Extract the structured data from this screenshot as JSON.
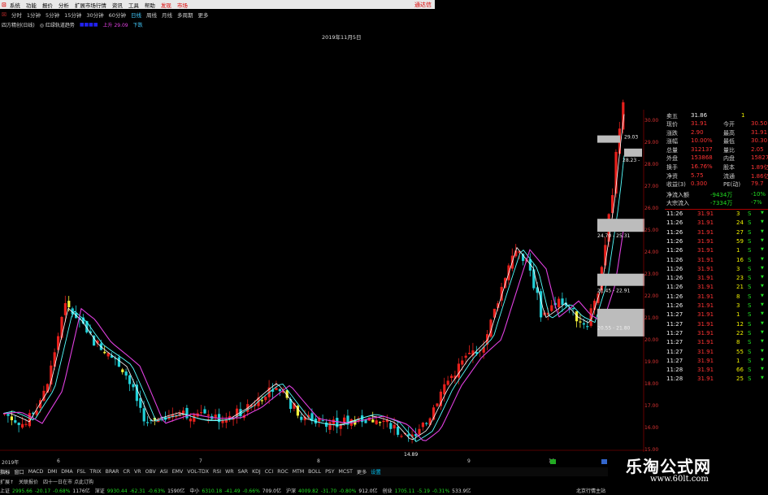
{
  "menubar": {
    "items": [
      "系统",
      "功能",
      "报价",
      "分析",
      "扩展市场行情",
      "资讯",
      "工具",
      "帮助"
    ],
    "highlight": [
      "发现",
      "市场"
    ],
    "close_label": "通达信"
  },
  "periods": {
    "items": [
      "分时",
      "1分钟",
      "5分钟",
      "15分钟",
      "30分钟",
      "60分钟",
      "日线",
      "周线",
      "月线",
      "多周期",
      "更多"
    ],
    "selected": "日线"
  },
  "indicator_line": {
    "name": "四方精创(日线)",
    "study": "◎ 红绿轨道趋势",
    "v1": "上升 29.09",
    "v2": "下跌"
  },
  "chart": {
    "date_header": "2019年11月5日",
    "price_ticks": [
      "30.00",
      "29.00",
      "28.00",
      "27.00",
      "26.00",
      "25.00",
      "24.00",
      "23.00",
      "22.00",
      "21.00",
      "20.00",
      "19.00",
      "18.00",
      "17.00",
      "16.00",
      "15.00"
    ],
    "low_label": "14.89",
    "zone_labels": [
      "29.03",
      "28.23 -",
      "24.70 - 25.31",
      "21.45 - 22.91",
      "20.55 - 21.80"
    ],
    "x_labels": [
      "2019年",
      "6",
      "7",
      "8",
      "9",
      "10"
    ],
    "colors": {
      "up": "#e8201c",
      "down": "#22d0d8",
      "yellow": "#f5f23a",
      "ma_white": "#ffffff",
      "ma_cyan": "#5ff",
      "ma_magenta": "#e040e0"
    }
  },
  "quote_panel": {
    "top": [
      {
        "label": "卖五",
        "value": "31.86",
        "vol": "1"
      },
      {
        "label": "现价",
        "value": "31.91",
        "k2": "今开",
        "v2": "30.50"
      },
      {
        "label": "涨跌",
        "value": "2.90",
        "k2": "最高",
        "v2": "31.91"
      },
      {
        "label": "涨幅",
        "value": "10.00%",
        "k2": "最低",
        "v2": "30.30"
      },
      {
        "label": "总量",
        "value": "312137",
        "k2": "量比",
        "v2": "2.05"
      },
      {
        "label": "外盘",
        "value": "153868",
        "k2": "内盘",
        "v2": "158277"
      },
      {
        "label": "换手",
        "value": "16.76%",
        "k2": "股本",
        "v2": "1.89亿"
      },
      {
        "label": "净资",
        "value": "5.75",
        "k2": "流通",
        "v2": "1.86亿"
      },
      {
        "label": "收益(3)",
        "value": "0.300",
        "k2": "PE(动)",
        "v2": "79.7"
      },
      {
        "label": "净流入额",
        "value": "-9434万",
        "v2": "-10%"
      },
      {
        "label": "大宗流入",
        "value": "-7334万",
        "v2": "-7%"
      }
    ],
    "ticks": [
      {
        "t": "11:26",
        "p": "31.91",
        "v": "3",
        "s": "S"
      },
      {
        "t": "11:26",
        "p": "31.91",
        "v": "24",
        "s": "S"
      },
      {
        "t": "11:26",
        "p": "31.91",
        "v": "27",
        "s": "S"
      },
      {
        "t": "11:26",
        "p": "31.91",
        "v": "59",
        "s": "S"
      },
      {
        "t": "11:26",
        "p": "31.91",
        "v": "1",
        "s": "S"
      },
      {
        "t": "11:26",
        "p": "31.91",
        "v": "16",
        "s": "S"
      },
      {
        "t": "11:26",
        "p": "31.91",
        "v": "3",
        "s": "S"
      },
      {
        "t": "11:26",
        "p": "31.91",
        "v": "23",
        "s": "S"
      },
      {
        "t": "11:26",
        "p": "31.91",
        "v": "21",
        "s": "S"
      },
      {
        "t": "11:26",
        "p": "31.91",
        "v": "8",
        "s": "S"
      },
      {
        "t": "11:26",
        "p": "31.91",
        "v": "3",
        "s": "S"
      },
      {
        "t": "11:27",
        "p": "31.91",
        "v": "1",
        "s": "S"
      },
      {
        "t": "11:27",
        "p": "31.91",
        "v": "12",
        "s": "S"
      },
      {
        "t": "11:27",
        "p": "31.91",
        "v": "22",
        "s": "S"
      },
      {
        "t": "11:27",
        "p": "31.91",
        "v": "8",
        "s": "S"
      },
      {
        "t": "11:27",
        "p": "31.91",
        "v": "55",
        "s": "S"
      },
      {
        "t": "11:27",
        "p": "31.91",
        "v": "1",
        "s": "S"
      },
      {
        "t": "11:28",
        "p": "31.91",
        "v": "66",
        "s": "S"
      },
      {
        "t": "11:28",
        "p": "31.91",
        "v": "25",
        "s": "S"
      }
    ]
  },
  "indicator_tabs": {
    "items": [
      "指标",
      "窗口",
      "MACD",
      "DMI",
      "DMA",
      "FSL",
      "TRIX",
      "BRAR",
      "CR",
      "VR",
      "OBV",
      "ASI",
      "EMV",
      "VOL-TDX",
      "RSI",
      "WR",
      "SAR",
      "KDJ",
      "CCI",
      "ROC",
      "MTM",
      "BOLL",
      "PSY",
      "MCST",
      "更多",
      "设置"
    ],
    "selected": "指标"
  },
  "sub_tabs": {
    "items": [
      "扩展↑",
      "关联报价",
      "四十一日在市 点此订购"
    ]
  },
  "statusbar": {
    "items": [
      {
        "n": "上证",
        "v": "2995.66",
        "c": "-20.17",
        "p": "-0.68%",
        "a": "1176亿"
      },
      {
        "n": "深证",
        "v": "9930.44",
        "c": "-62.31",
        "p": "-0.63%",
        "a": "1590亿"
      },
      {
        "n": "中小",
        "v": "6310.18",
        "c": "-41.49",
        "p": "-0.66%",
        "a": "709.0亿"
      },
      {
        "n": "沪深",
        "v": "4009.82",
        "c": "-31.70",
        "p": "-0.80%",
        "a": "912.0亿"
      },
      {
        "n": "创业",
        "v": "1705.11",
        "c": "-5.19",
        "p": "-0.31%",
        "a": "533.9亿"
      }
    ],
    "right_label": "北京行情主站"
  },
  "watermark": {
    "title": "乐淘公式网",
    "url": "www.60lt.com"
  }
}
